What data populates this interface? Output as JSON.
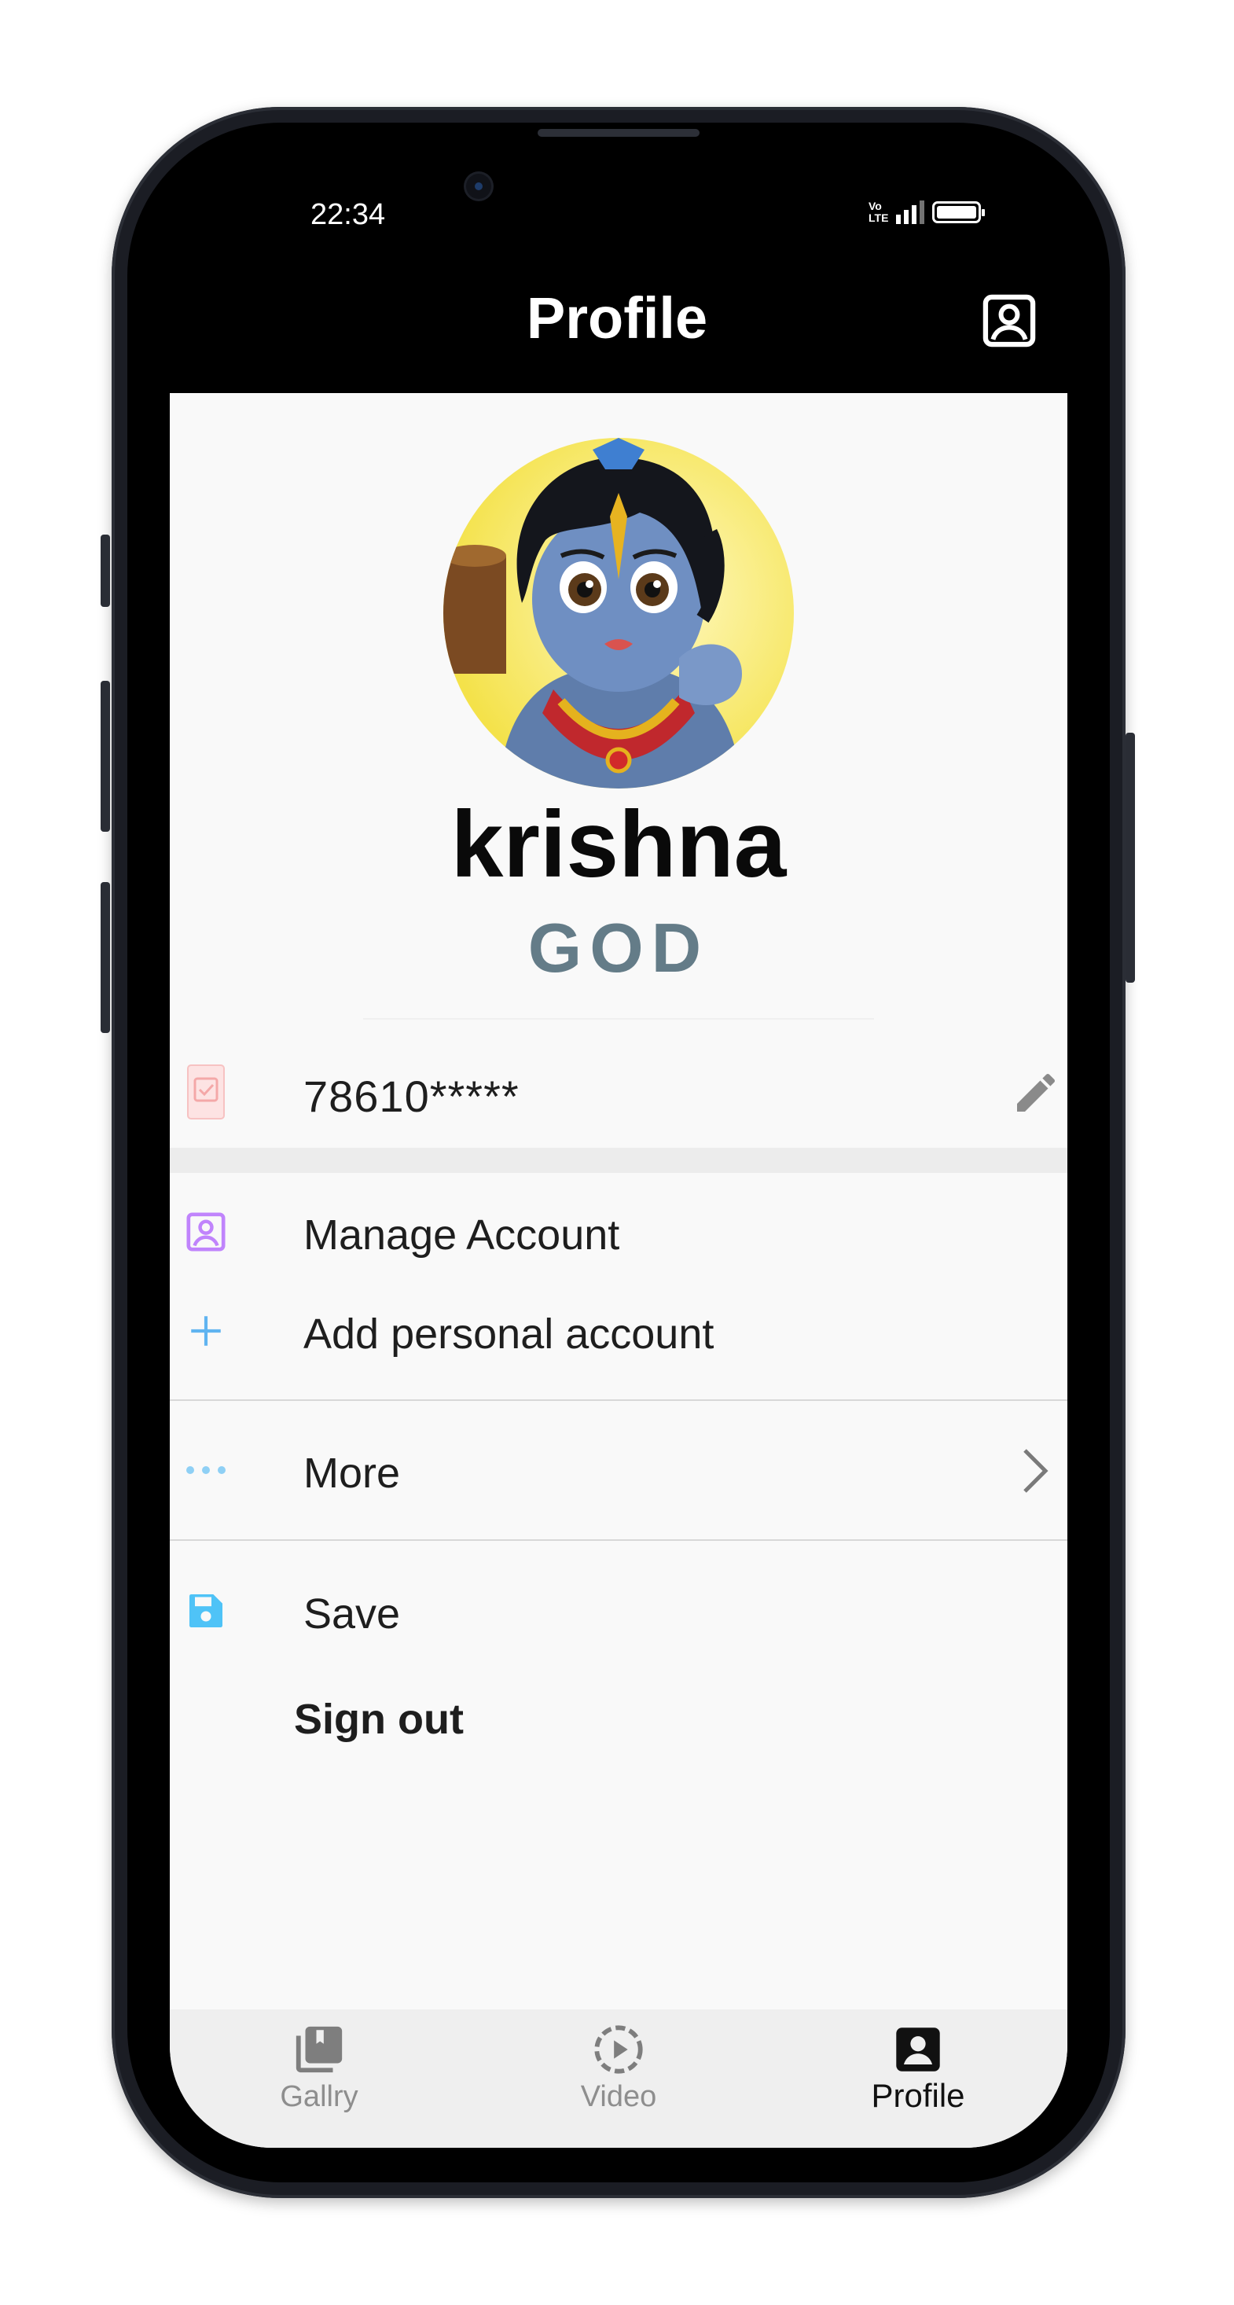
{
  "status_bar": {
    "time": "22:34",
    "network_badge": "Vo\nLTE"
  },
  "app_bar": {
    "title": "Profile",
    "action_icon": "account-box-icon"
  },
  "profile": {
    "name": "krishna",
    "role": "GOD",
    "phone": "78610*****"
  },
  "menu": {
    "manage_account": "Manage Account",
    "add_personal_account": "Add personal account",
    "more": "More",
    "save": "Save",
    "sign_out": "Sign out"
  },
  "bottom_nav": [
    {
      "label": "Gallry",
      "icon": "gallery-icon",
      "active": false
    },
    {
      "label": "Video",
      "icon": "video-play-icon",
      "active": false
    },
    {
      "label": "Profile",
      "icon": "profile-icon",
      "active": true
    }
  ],
  "colors": {
    "role": "#647c88",
    "manage_account_icon": "#c084fc",
    "add_icon": "#60b4f0",
    "save_icon": "#4fc3f7",
    "phone_icon": "#f7c2c2"
  }
}
